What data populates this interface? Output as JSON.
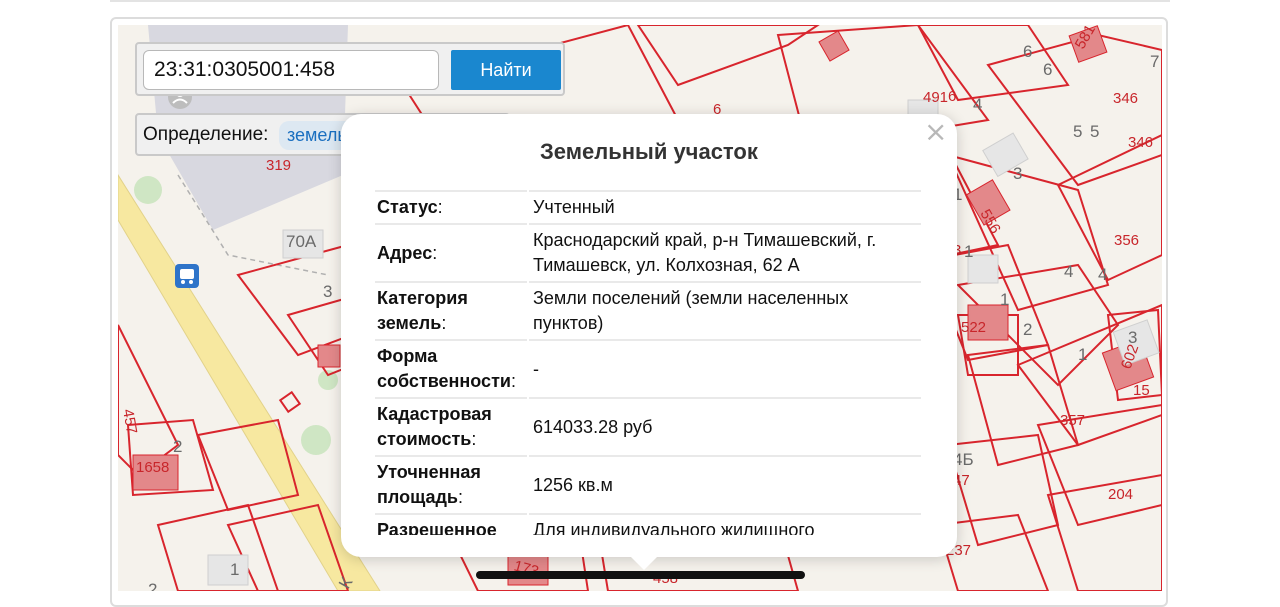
{
  "search": {
    "query": "23:31:0305001:458",
    "button_label": "Найти"
  },
  "definition": {
    "label": "Определение:",
    "selected": "земельный участок"
  },
  "popup": {
    "close_glyph": "×",
    "title": "Земельный участок",
    "rows": [
      {
        "key": "Статус",
        "value": "Учтенный"
      },
      {
        "key": "Адрес",
        "value": "Краснодарский край, р-н Тимашевский, г. Тимашевск, ул. Колхозная, 62 А"
      },
      {
        "key": "Категория земель",
        "value": "Земли поселений (земли населенных пунктов)"
      },
      {
        "key": "Форма собственности",
        "value": "-"
      },
      {
        "key": "Кадастровая стоимость",
        "value": "614033.28 руб"
      },
      {
        "key": "Уточненная площадь",
        "value": "1256 кв.м"
      },
      {
        "key": "Разрешенное",
        "value": "Для индивидуального жилищного"
      }
    ]
  },
  "map": {
    "plot_labels": [
      "581",
      "491",
      "346",
      "346",
      "6",
      "319",
      "556",
      "356",
      "70А",
      "522",
      "602",
      "15",
      "357",
      "457",
      "1658",
      "204",
      "173",
      "458",
      "6",
      "237",
      "47",
      "3",
      "1"
    ],
    "house_labels": [
      "6",
      "6",
      "7",
      "4",
      "5",
      "5",
      "3",
      "1",
      "4",
      "4",
      "1",
      "2",
      "1",
      "3",
      "2",
      "4Б",
      "1",
      "2",
      "1",
      "3",
      "К"
    ],
    "colors": {
      "boundary": "#d8252d",
      "building": "#e3888a",
      "road": "#f7e8a0",
      "park": "#cfe6c4"
    }
  }
}
